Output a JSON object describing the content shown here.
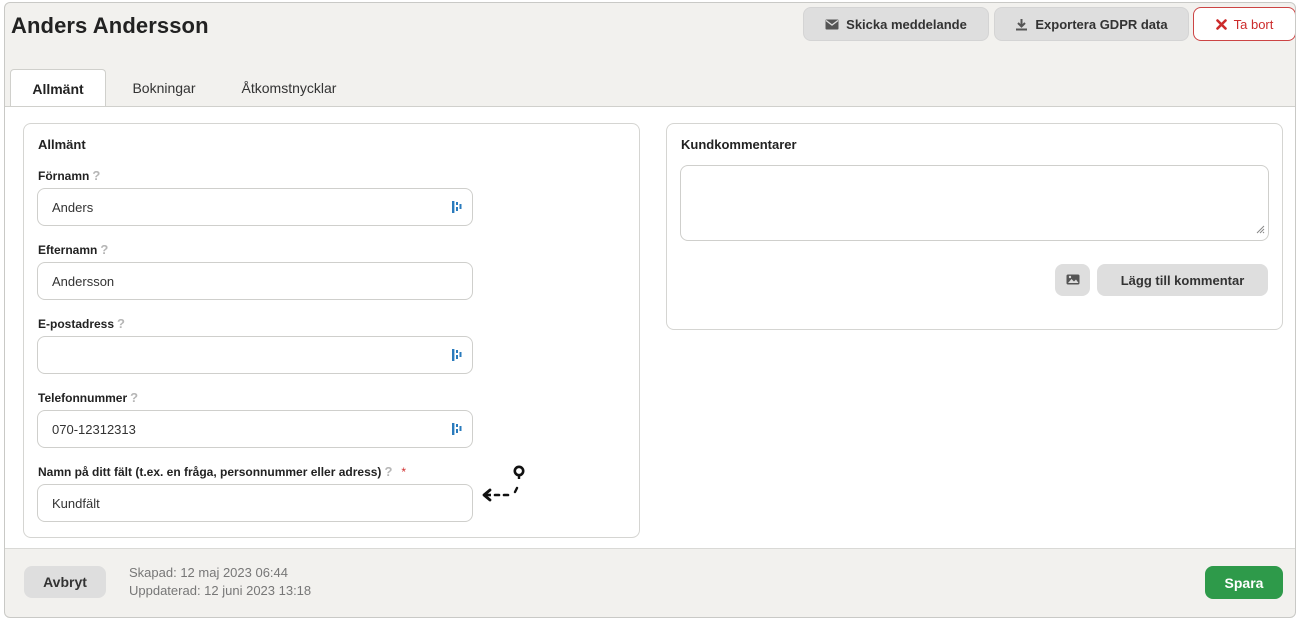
{
  "header": {
    "title": "Anders Andersson",
    "send_message_label": "Skicka meddelande",
    "export_gdpr_label": "Exportera GDPR data",
    "delete_label": "Ta bort"
  },
  "tabs": [
    {
      "label": "Allmänt",
      "active": true
    },
    {
      "label": "Bokningar",
      "active": false
    },
    {
      "label": "Åtkomstnycklar",
      "active": false
    }
  ],
  "general": {
    "title": "Allmänt",
    "fields": [
      {
        "label": "Förnamn",
        "value": "Anders",
        "help": "?"
      },
      {
        "label": "Efternamn",
        "value": "Andersson",
        "help": "?"
      },
      {
        "label": "E-postadress",
        "value": "",
        "help": "?"
      },
      {
        "label": "Telefonnummer",
        "value": "070-12312313",
        "help": "?"
      },
      {
        "label": "Namn på ditt fält (t.ex. en fråga, personnummer eller adress)",
        "value": "Kundfält",
        "help": "?",
        "required_mark": "*"
      }
    ]
  },
  "comments": {
    "title": "Kundkommentarer",
    "value": "",
    "add_label": "Lägg till kommentar"
  },
  "footer": {
    "cancel_label": "Avbryt",
    "created": "Skapad: 12 maj 2023 06:44",
    "updated": "Uppdaterad: 12 juni 2023 13:18",
    "save_label": "Spara"
  },
  "colors": {
    "save": "#2e9a4a",
    "delete": "#cc2b2b",
    "background": "#f2f1ee"
  },
  "icons": [
    "envelope-icon",
    "download-icon",
    "close-icon",
    "password-manager-icon",
    "image-icon",
    "resize-grip-icon",
    "help-icon",
    "cursor-icon"
  ]
}
